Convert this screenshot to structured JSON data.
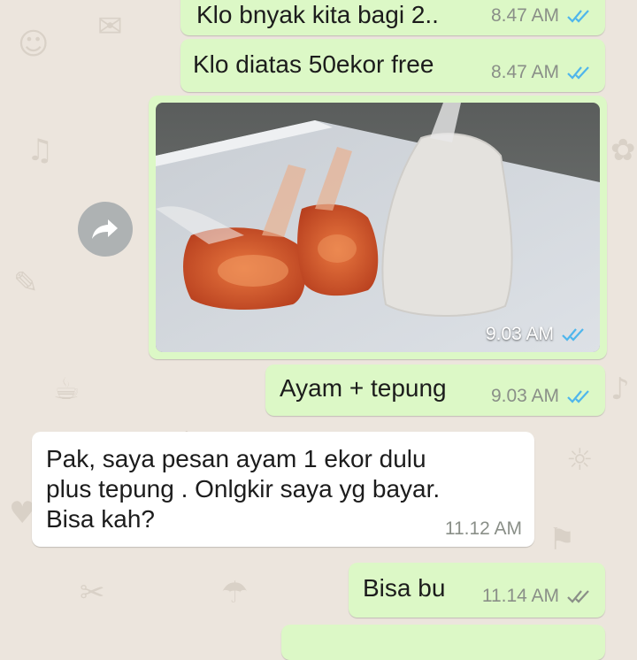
{
  "colors": {
    "outgoing_bubble": "#dcf8c6",
    "incoming_bubble": "#ffffff",
    "read_ticks": "#4fb6ec",
    "delivered_ticks": "#8a8f88",
    "background": "#ece5dd"
  },
  "messages": [
    {
      "direction": "outgoing",
      "text": "Klo bnyak kita bagi 2..",
      "time": "8.47 AM",
      "status": "read"
    },
    {
      "direction": "outgoing",
      "text": "Klo diatas 50ekor free",
      "time": "8.47 AM",
      "status": "read"
    },
    {
      "direction": "outgoing",
      "type": "image",
      "image_icon": "photo-chicken-and-flour-bags",
      "time": "9.03 AM",
      "status": "read"
    },
    {
      "direction": "outgoing",
      "text": "Ayam + tepung",
      "time": "9.03 AM",
      "status": "read"
    },
    {
      "direction": "incoming",
      "lines": [
        "Pak, saya pesan ayam 1 ekor dulu",
        "plus tepung . Onlgkir saya yg bayar.",
        "Bisa kah?"
      ],
      "time": "11.12 AM"
    },
    {
      "direction": "outgoing",
      "text": "Bisa bu",
      "time": "11.14 AM",
      "status": "delivered"
    }
  ],
  "forward_icon": "forward-share-icon"
}
